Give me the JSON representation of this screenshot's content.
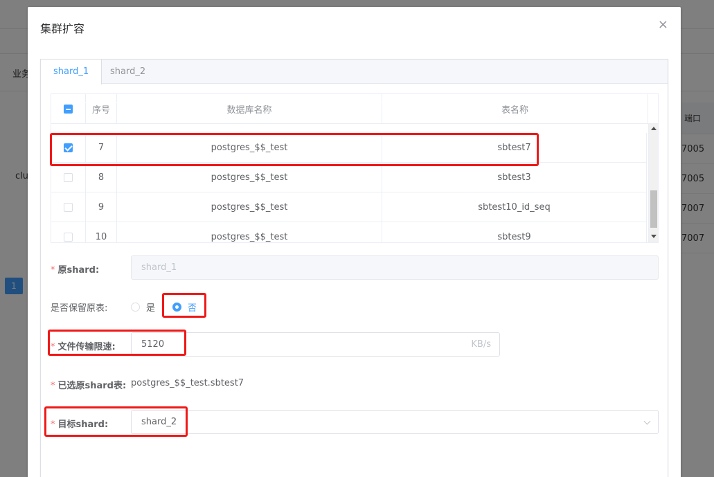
{
  "background": {
    "tab_label": "业务",
    "cell_left": "clus",
    "column_header": "端口",
    "ports": [
      "7005",
      "7005",
      "7007",
      "7007"
    ],
    "page_number": "1"
  },
  "dialog": {
    "title": "集群扩容",
    "close_glyph": "×",
    "tabs": [
      {
        "label": "shard_1",
        "active": true
      },
      {
        "label": "shard_2",
        "active": false
      }
    ],
    "table": {
      "headers": {
        "index": "序号",
        "db_name": "数据库名称",
        "table_name": "表名称"
      },
      "rows": [
        {
          "checked": true,
          "index": "7",
          "db_name": "postgres_$$_test",
          "table_name": "sbtest7"
        },
        {
          "checked": false,
          "index": "8",
          "db_name": "postgres_$$_test",
          "table_name": "sbtest3"
        },
        {
          "checked": false,
          "index": "9",
          "db_name": "postgres_$$_test",
          "table_name": "sbtest10_id_seq"
        },
        {
          "checked": false,
          "index": "10",
          "db_name": "postgres_$$_test",
          "table_name": "sbtest9"
        }
      ]
    },
    "form": {
      "source_shard": {
        "label": "原shard:",
        "value": "shard_1"
      },
      "keep_original": {
        "label": "是否保留原表:",
        "option_yes": "是",
        "option_no": "否",
        "selected": "否"
      },
      "rate_limit": {
        "label": "文件传输限速:",
        "value": "5120",
        "unit": "KB/s"
      },
      "selected_tables": {
        "label": "已选原shard表:",
        "value": "postgres_$$_test.sbtest7"
      },
      "target_shard": {
        "label": "目标shard:",
        "value": "shard_2"
      }
    }
  },
  "colors": {
    "accent": "#409eff",
    "highlight": "#f01818",
    "required": "#f56c6c"
  }
}
